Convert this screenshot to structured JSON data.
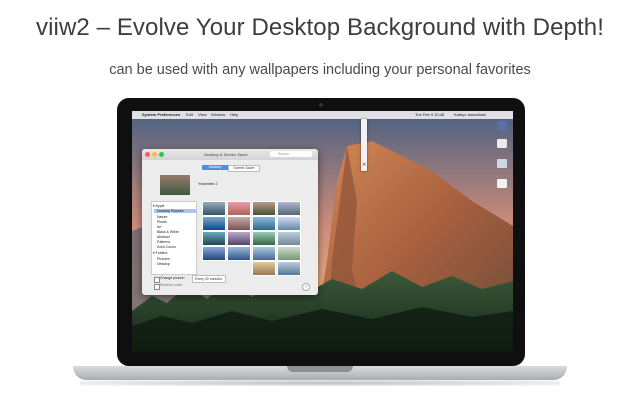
{
  "headline": "viiw2 – Evolve Your Desktop Background with Depth!",
  "subline": "can be used with any wallpapers including your personal favorites",
  "menubar": {
    "items": [
      "System Preferences",
      "Edit",
      "View",
      "Window",
      "Help"
    ],
    "clock": "Tue Feb 9 10:48",
    "user": "Kateyo Iamadhani"
  },
  "window": {
    "title": "Desktop & Screen Saver",
    "search_placeholder": "Search",
    "tabs": [
      "Desktop",
      "Screen Saver"
    ],
    "current_picture": "Yosemite 2",
    "sidebar_items": [
      "▾ Apple",
      "Desktop Pictures",
      "Nature",
      "Plants",
      "Art",
      "Black & White",
      "Abstract",
      "Patterns",
      "Solid Colors",
      "▾ Folders",
      "Pictures",
      "Desktop"
    ],
    "change_picture_label": "Change picture:",
    "change_picture_value": "Every 30 minutes",
    "random_order_label": "Random order"
  },
  "colors": {
    "headline": "#3d3d3d",
    "bezel": "#0f0f10",
    "sky_top": "#55708f",
    "sky_bottom": "#e7a878",
    "rock": "#b9724a",
    "forest": "#233a26"
  }
}
